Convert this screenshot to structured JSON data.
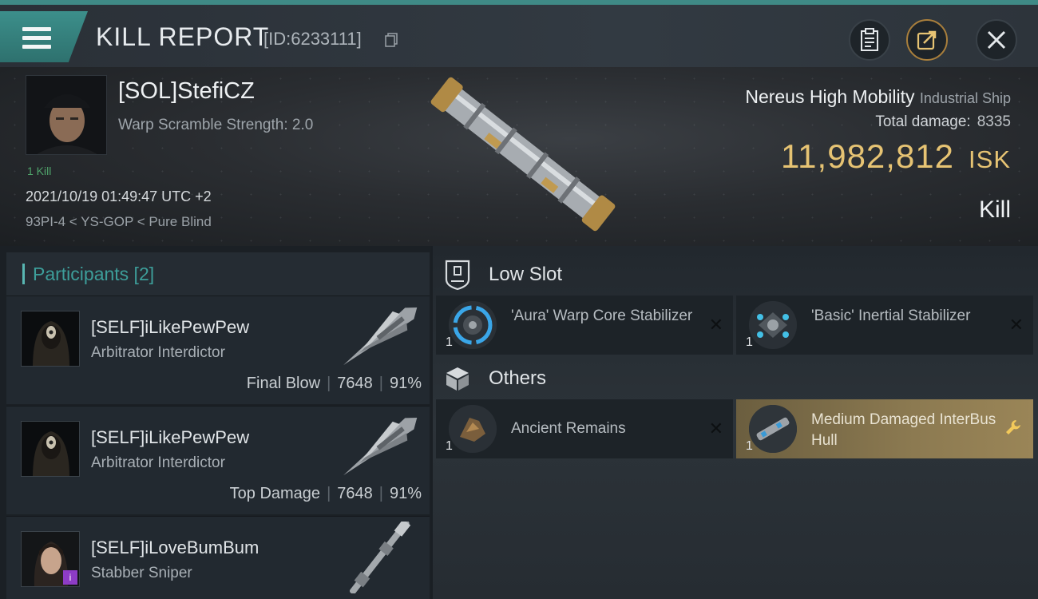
{
  "header": {
    "title": "KILL REPORT",
    "report_id": "[ID:6233111]",
    "buttons": [
      {
        "name": "clipboard-icon"
      },
      {
        "name": "share-icon"
      },
      {
        "name": "close-icon"
      }
    ]
  },
  "kill": {
    "pilot": "[SOL]StefiCZ",
    "warp_scramble": "Warp Scramble Strength: 2.0",
    "kill_tag": "1 Kill",
    "datetime": "2021/10/19 01:49:47 UTC +2",
    "location": "93PI-4 < YS-GOP < Pure Blind",
    "ship_name": "Nereus High Mobility",
    "ship_class": "Industrial Ship",
    "total_damage_label": "Total damage:",
    "total_damage": "8335",
    "isk_value": "11,982,812",
    "isk_unit": "ISK",
    "result": "Kill"
  },
  "participants": {
    "header": "Participants [2]",
    "rows": [
      {
        "name": "[SELF]iLikePewPew",
        "ship": "Arbitrator Interdictor",
        "role": "Final Blow",
        "damage": "7648",
        "percent": "91%"
      },
      {
        "name": "[SELF]iLikePewPew",
        "ship": "Arbitrator Interdictor",
        "role": "Top Damage",
        "damage": "7648",
        "percent": "91%"
      },
      {
        "name": "[SELF]iLoveBumBum",
        "ship": "Stabber Sniper",
        "badge": "i"
      }
    ]
  },
  "items": {
    "low_slot_title": "Low Slot",
    "others_title": "Others",
    "low_slot": [
      {
        "name": "'Aura' Warp Core Stabilizer",
        "qty": "1",
        "status": "destroyed"
      },
      {
        "name": "'Basic' Inertial Stabilizer",
        "qty": "1",
        "status": "destroyed"
      }
    ],
    "others": [
      {
        "name": "Ancient Remains",
        "qty": "1",
        "status": "destroyed"
      },
      {
        "name": "Medium Damaged InterBus Hull",
        "qty": "1",
        "status": "dropped"
      }
    ]
  },
  "colors": {
    "accent": "#3f8a86",
    "isk": "#e6c373",
    "dropped_item": "#8c7a51"
  }
}
